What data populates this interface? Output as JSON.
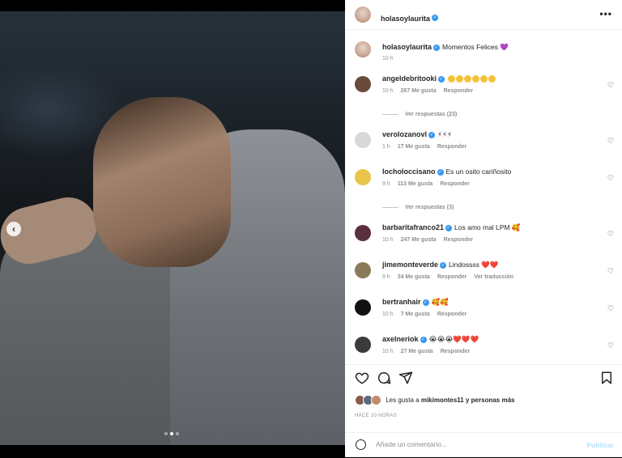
{
  "post": {
    "owner": "holasoylaurita",
    "caption_text": "Momentos Felices 💜",
    "caption_time": "10 h",
    "likes_prefix": "Les gusta a",
    "likes_user": "mikimontes11",
    "likes_suffix": "y personas más",
    "timestamp": "HACE 10 HORAS",
    "comment_placeholder": "Añade un comentario...",
    "publish_label": "Publicar",
    "slide_count": 3,
    "active_slide": 2
  },
  "comments": [
    {
      "user": "angeldebritooki",
      "text": "",
      "emoji_count": 6,
      "emoji_color": "#f5c33b",
      "time": "10 h",
      "likes": "267 Me gusta",
      "reply": "Responder",
      "translate": "",
      "replies": "Ver respuestas (23)"
    },
    {
      "user": "verolozanovl",
      "text": "⚡⚡⚡",
      "emoji_count": 0,
      "emoji_color": "",
      "time": "1 h",
      "likes": "17 Me gusta",
      "reply": "Responder",
      "translate": "",
      "replies": ""
    },
    {
      "user": "locholoccisano",
      "text": "Es un osito cariñosito",
      "emoji_count": 0,
      "emoji_color": "",
      "time": "9 h",
      "likes": "113 Me gusta",
      "reply": "Responder",
      "translate": "",
      "replies": "Ver respuestas (3)"
    },
    {
      "user": "barbaritafranco21",
      "text": "Los amo mal LPM 🥰",
      "emoji_count": 0,
      "emoji_color": "",
      "time": "10 h",
      "likes": "247 Me gusta",
      "reply": "Responder",
      "translate": "",
      "replies": ""
    },
    {
      "user": "jimemonteverde",
      "text": "Lindossss ❤️❤️",
      "emoji_count": 0,
      "emoji_color": "",
      "time": "9 h",
      "likes": "34 Me gusta",
      "reply": "Responder",
      "translate": "Ver traducción",
      "replies": ""
    },
    {
      "user": "bertranhair",
      "text": "🥰🥰",
      "emoji_count": 0,
      "emoji_color": "",
      "time": "10 h",
      "likes": "7 Me gusta",
      "reply": "Responder",
      "translate": "",
      "replies": ""
    },
    {
      "user": "axelneriok",
      "text": "😭😭😭❤️❤️❤️",
      "emoji_count": 0,
      "emoji_color": "",
      "time": "10 h",
      "likes": "27 Me gusta",
      "reply": "Responder",
      "translate": "",
      "replies": ""
    }
  ],
  "colors": {
    "verified": "#3897f0",
    "text": "#262626",
    "muted": "#8e8e8e",
    "publish": "#b2dffc"
  }
}
